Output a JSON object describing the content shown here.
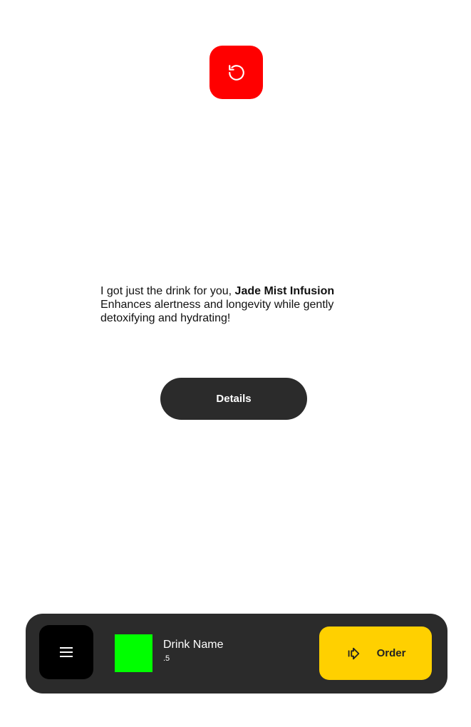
{
  "colors": {
    "reset_bg": "#ff0000",
    "details_bg": "#2b2b2b",
    "bar_bg": "#2b2b2b",
    "menu_bg": "#000000",
    "swatch": "#00ff00",
    "order_bg": "#ffd000"
  },
  "reset": {
    "icon": "rotate-ccw-icon"
  },
  "message": {
    "intro": "I got just the drink for you, ",
    "drink_name": "Jade Mist Infusion",
    "description": "Enhances alertness and longevity while gently detoxifying and hydrating!"
  },
  "details_button": {
    "label": "Details"
  },
  "bottom_bar": {
    "menu_icon": "hamburger-menu-icon",
    "drink_name": "Drink Name",
    "drink_size": ".5",
    "order_icon": "arrow-right-icon",
    "order_label": "Order"
  }
}
